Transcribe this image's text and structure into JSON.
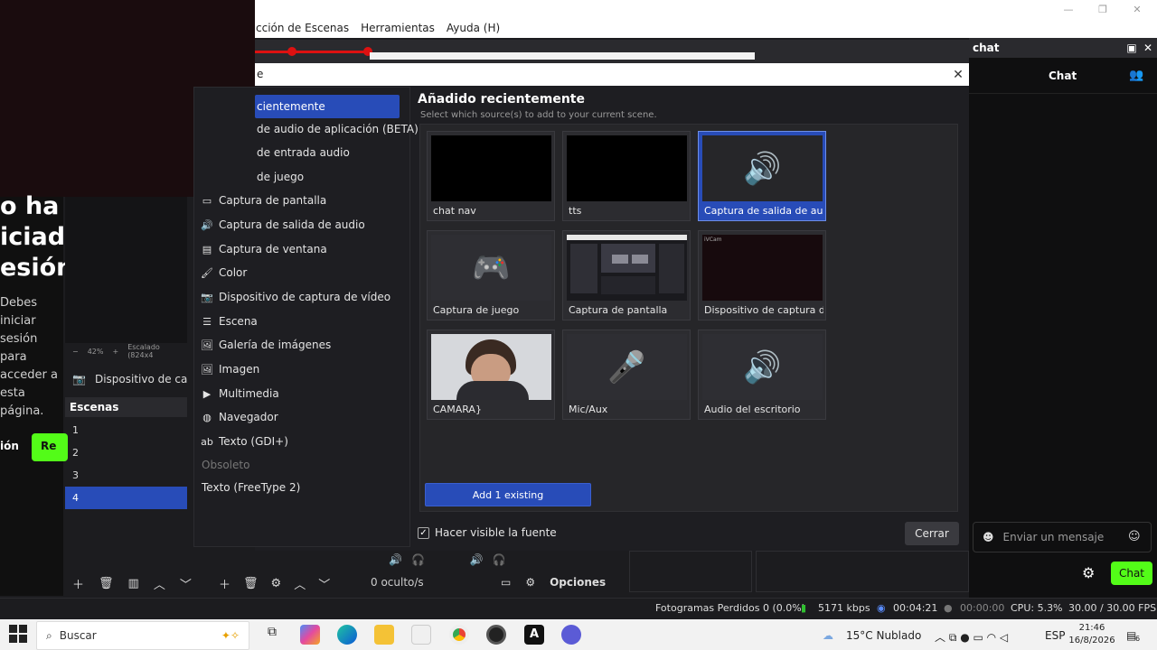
{
  "menubar": {
    "items": [
      "cción de Escenas",
      "Herramientas",
      "Ayuda (H)"
    ]
  },
  "window_controls": [
    "—",
    "❐",
    "✕"
  ],
  "web_page": {
    "heading_lines": [
      "o ha",
      "iciad",
      "esión"
    ],
    "paragraph_lines": [
      "Debes",
      "iniciar",
      "sesión",
      "para",
      "acceder a",
      "esta",
      "página."
    ],
    "link": "ión",
    "button": "Re"
  },
  "obs_left": {
    "zoom": [
      "−",
      "42%",
      "+",
      "Escalado (824x4"
    ],
    "source_item": "Dispositivo de captur",
    "scenes_header": "Escenas",
    "scenes": [
      "1",
      "2",
      "3",
      "4"
    ],
    "selected_scene_index": 3,
    "hidden_count": "0 oculto/s",
    "options_label": "Opciones"
  },
  "dialog": {
    "title": "e",
    "close": "✕",
    "source_types": [
      {
        "label": "cientemente",
        "icon": ""
      },
      {
        "label": "de audio de aplicación (BETA)",
        "icon": ""
      },
      {
        "label": "de entrada audio",
        "icon": ""
      },
      {
        "label": "de juego",
        "icon": ""
      },
      {
        "label": "Captura de pantalla",
        "icon": "▭"
      },
      {
        "label": "Captura de salida de audio",
        "icon": "🔊"
      },
      {
        "label": "Captura de ventana",
        "icon": "▤"
      },
      {
        "label": "Color",
        "icon": "🖌"
      },
      {
        "label": "Dispositivo de captura de vídeo",
        "icon": "📷"
      },
      {
        "label": "Escena",
        "icon": "☰"
      },
      {
        "label": "Galería de imágenes",
        "icon": "🖼"
      },
      {
        "label": "Imagen",
        "icon": "🖼"
      },
      {
        "label": "Multimedia",
        "icon": "▶"
      },
      {
        "label": "Navegador",
        "icon": "◍"
      },
      {
        "label": "Texto (GDI+)",
        "icon": "ab"
      }
    ],
    "deprecated_header": "Obsoleto",
    "deprecated_items": [
      "Texto (FreeType 2)"
    ],
    "section_title": "Añadido recientemente",
    "section_subtitle": "Select which source(s) to add to your current scene.",
    "cards": [
      {
        "label": "chat nav",
        "thumb": "black",
        "icon": ""
      },
      {
        "label": "tts",
        "thumb": "black",
        "icon": ""
      },
      {
        "label": "Captura de salida de audio",
        "thumb": "icon",
        "icon": "🔊",
        "selected": true
      },
      {
        "label": "Captura de juego",
        "thumb": "icon",
        "icon": "🎮"
      },
      {
        "label": "Captura de pantalla",
        "thumb": "screen",
        "icon": ""
      },
      {
        "label": "Dispositivo de captura de",
        "thumb": "dark",
        "icon": "",
        "overlay": "iVCam"
      },
      {
        "label": "CAMARA}",
        "thumb": "camera",
        "icon": ""
      },
      {
        "label": "Mic/Aux",
        "thumb": "icon",
        "icon": "🎤"
      },
      {
        "label": "Audio del escritorio",
        "thumb": "icon",
        "icon": "🔊"
      }
    ],
    "add_button": "Add 1 existing",
    "visible_checkbox": "Hacer visible la fuente",
    "close_button": "Cerrar"
  },
  "chat": {
    "dock_title": "chat",
    "header": "Chat",
    "input_placeholder": "Enviar un mensaje",
    "send_button": "Chat"
  },
  "statusbar": {
    "dropped_frames": "Fotogramas Perdidos 0 (0.0%)",
    "bitrate": "5171 kbps",
    "stream_time": "00:04:21",
    "record_time": "00:00:00",
    "cpu": "CPU: 5.3%",
    "fps": "30.00 / 30.00 FPS"
  },
  "taskbar": {
    "search_placeholder": "Buscar",
    "weather": "15°C  Nublado",
    "language": "ESP",
    "time": "21:46",
    "date": "16/8/2026",
    "notifications": "6"
  },
  "colors": {
    "accent": "#284cb8",
    "kick_green": "#53fc18"
  }
}
